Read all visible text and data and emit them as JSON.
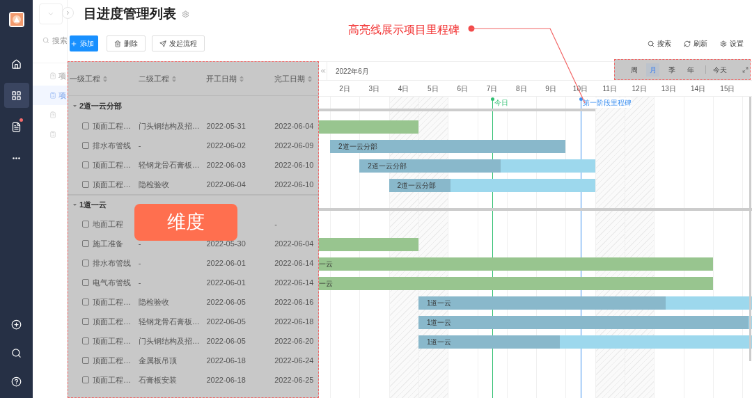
{
  "nav": {
    "items": [
      {
        "kind": "home",
        "selected": false,
        "badge": false
      },
      {
        "kind": "apps",
        "selected": true,
        "badge": false
      },
      {
        "kind": "report",
        "selected": false,
        "badge": true
      },
      {
        "kind": "more",
        "selected": false,
        "badge": false
      }
    ],
    "bottom": [
      {
        "kind": "add"
      },
      {
        "kind": "search"
      },
      {
        "kind": "help"
      }
    ]
  },
  "sidebar": {
    "search_placeholder": "搜索",
    "items": [
      {
        "label": "项",
        "selected": false
      },
      {
        "label": "项",
        "selected": true
      },
      {
        "selected": false
      },
      {
        "selected": false
      }
    ]
  },
  "title": "目进度管理列表",
  "toolbar": {
    "buttons": [
      {
        "kind": "primary",
        "label": "添加"
      },
      {
        "kind": "delete",
        "label": "删除"
      },
      {
        "kind": "flow",
        "label": "发起流程"
      }
    ],
    "actions": [
      {
        "kind": "search",
        "label": "搜索"
      },
      {
        "kind": "refresh",
        "label": "刷新"
      },
      {
        "kind": "settings",
        "label": "设置"
      }
    ]
  },
  "table": {
    "columns": [
      "一级工程",
      "二级工程",
      "开工日期",
      "完工日期"
    ],
    "groups": [
      {
        "name": "2道一云分部",
        "expanded": true,
        "rows": [
          {
            "level1": "顶面工程…",
            "level2": "门头钢结构及招…",
            "start": "2022-05-31",
            "end": "2022-06-04",
            "checked": false,
            "bar": {
              "kind": "plain"
            }
          },
          {
            "level1": "排水布管线",
            "level2": "-",
            "start": "2022-06-02",
            "end": "2022-06-09",
            "checked": false,
            "bar": {
              "kind": "progress",
              "label": "2道一云分部",
              "level": 1
            }
          },
          {
            "level1": "顶面工程…",
            "level2": "轻钢龙骨石膏板…",
            "start": "2022-06-03",
            "end": "2022-06-10",
            "checked": false,
            "bar": {
              "kind": "progress",
              "label": "2道一云分部",
              "level": 0.6
            }
          },
          {
            "level1": "顶面工程…",
            "level2": "隐检验收",
            "start": "2022-06-04",
            "end": "2022-06-10",
            "checked": false,
            "bar": {
              "kind": "progress",
              "label": "2道一云分部",
              "level": 0.3
            }
          }
        ]
      },
      {
        "name": "1道一云",
        "expanded": true,
        "rows": [
          {
            "level1": "地面工程",
            "end": "-",
            "checked": false
          },
          {
            "level1": "施工准备",
            "level2": "-",
            "start": "2022-05-30",
            "end": "2022-06-04",
            "checked": false,
            "bar": {
              "kind": "plain"
            }
          },
          {
            "level1": "排水布管线",
            "level2": "-",
            "start": "2022-06-01",
            "end": "2022-06-14",
            "checked": false,
            "bar": {
              "kind": "plain",
              "label": "一云"
            }
          },
          {
            "level1": "电气布管线",
            "level2": "-",
            "start": "2022-06-01",
            "end": "2022-06-14",
            "checked": false,
            "bar": {
              "kind": "plain",
              "label": "一云"
            }
          },
          {
            "level1": "顶面工程…",
            "level2": "隐检验收",
            "start": "2022-06-05",
            "end": "2022-06-16",
            "checked": false,
            "bar": {
              "kind": "progress",
              "label": "1道一云",
              "level": 0.7
            }
          },
          {
            "level1": "顶面工程…",
            "level2": "轻钢龙骨石膏板…",
            "start": "2022-06-05",
            "end": "2022-06-18",
            "checked": false,
            "bar": {
              "kind": "progress",
              "label": "1道一云",
              "level": 0.8
            }
          },
          {
            "level1": "顶面工程…",
            "level2": "门头钢结构及招…",
            "start": "2022-06-05",
            "end": "2022-06-20",
            "checked": false,
            "bar": {
              "kind": "progress",
              "label": "1道一云",
              "level": 0.3
            }
          },
          {
            "level1": "顶面工程…",
            "level2": "金属板吊顶",
            "start": "2022-06-18",
            "end": "2022-06-24",
            "checked": false
          },
          {
            "level1": "顶面工程…",
            "level2": "石膏板安装",
            "start": "2022-06-18",
            "end": "2022-06-25",
            "checked": false
          }
        ]
      }
    ]
  },
  "gantt": {
    "month": "2022年6月",
    "views": [
      {
        "label": "周",
        "selected": false
      },
      {
        "label": "月",
        "selected": true
      },
      {
        "label": "季",
        "selected": false
      },
      {
        "label": "年",
        "selected": false
      }
    ],
    "today_button": "今天",
    "days": [
      {
        "label": "2日",
        "weekend": false
      },
      {
        "label": "3日",
        "weekend": false
      },
      {
        "label": "4日",
        "weekend": true
      },
      {
        "label": "5日",
        "weekend": true
      },
      {
        "label": "6日",
        "weekend": false
      },
      {
        "label": "7日",
        "weekend": false,
        "marker": {
          "label": "今日",
          "color": "#2fbf71"
        }
      },
      {
        "label": "8日",
        "weekend": false
      },
      {
        "label": "9日",
        "weekend": false
      },
      {
        "label": "10日",
        "weekend": false,
        "marker": {
          "label": "第一阶段里程碑",
          "color": "#3b8ff0"
        }
      },
      {
        "label": "11日",
        "weekend": true
      },
      {
        "label": "12日",
        "weekend": true
      },
      {
        "label": "13日",
        "weekend": false
      },
      {
        "label": "14日",
        "weekend": false
      },
      {
        "label": "15日",
        "weekend": false
      }
    ]
  },
  "annotations": [
    {
      "kind": "callout",
      "text": "高亮线展示项目里程碑"
    },
    {
      "kind": "tag",
      "text": "维度"
    }
  ]
}
